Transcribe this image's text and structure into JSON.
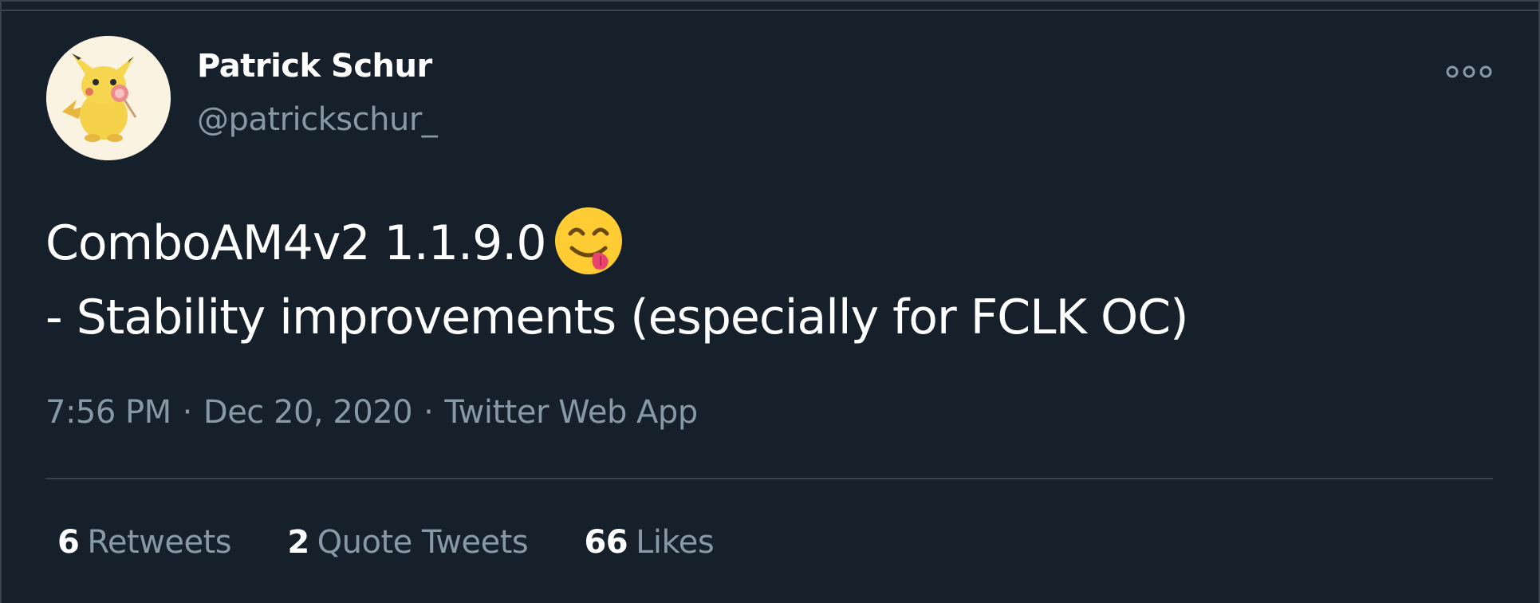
{
  "author": {
    "display_name": "Patrick Schur",
    "handle": "@patrickschur_",
    "avatar_icon": "pikachu-avatar"
  },
  "tweet": {
    "line1": "ComboAM4v2 1.1.9.0",
    "line1_emoji": "face-savoring-food-emoji",
    "line2": "- Stability improvements (especially for FCLK OC)"
  },
  "meta": {
    "time": "7:56 PM",
    "date": "Dec 20, 2020",
    "separator": "·",
    "source": "Twitter Web App"
  },
  "stats": {
    "retweets": {
      "count": "6",
      "label": "Retweets"
    },
    "quote_tweets": {
      "count": "2",
      "label": "Quote Tweets"
    },
    "likes": {
      "count": "66",
      "label": "Likes"
    }
  },
  "menu": {
    "icon": "more-options-icon"
  },
  "colors": {
    "background": "#15202b",
    "primary_text": "#ffffff",
    "secondary_text": "#8899a6",
    "border": "#38444d"
  }
}
